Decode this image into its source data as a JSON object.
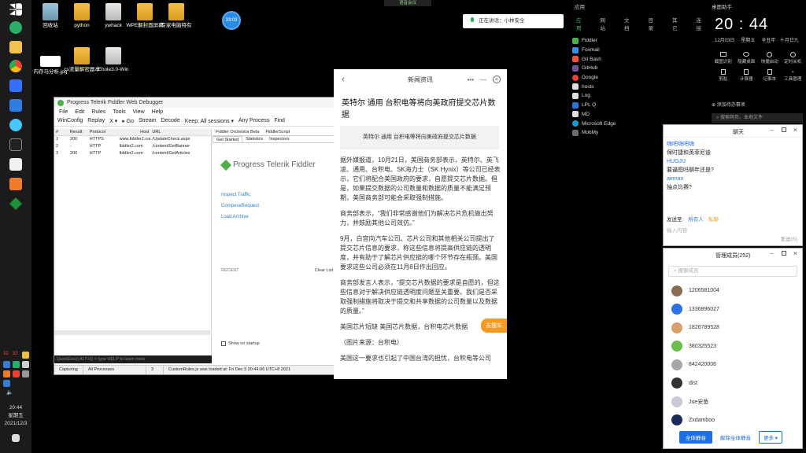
{
  "taskbar": {
    "time": "20:44",
    "weekday": "星期五",
    "date": "2021/12/3",
    "tray_badges": [
      "32",
      "32"
    ]
  },
  "desktop_icons": [
    {
      "label": "回收站"
    },
    {
      "label": "python"
    },
    {
      "label": "ywhack"
    },
    {
      "label": "WPE解封面屏幕"
    },
    {
      "label": "专家电脑特有"
    },
    {
      "label": "内存马分析.jpg"
    },
    {
      "label": "cs流量解密器本"
    },
    {
      "label": "Ehole3.0-Win"
    }
  ],
  "floating_badge": "33:03",
  "top_bar": {
    "text": "语音会议"
  },
  "meeting_pill": {
    "text": "正在讲话：小林安全"
  },
  "fiddler": {
    "title": "Progress Telerik Fiddler Web Debugger",
    "menu": [
      "File",
      "Edit",
      "Rules",
      "Tools",
      "View",
      "Help"
    ],
    "toolbar": [
      "WinConfig",
      "Replay",
      "X ▾",
      "▸ Go",
      "Stream",
      "Decode",
      "Keep: All sessions ▾",
      "Any Process",
      "Find"
    ],
    "columns": [
      "#",
      "Result",
      "Protocol",
      "Host",
      "URL"
    ],
    "sessions": [
      {
        "num": "1",
        "result": "200",
        "protocol": "HTTPS",
        "host": "www.fiddler2.com",
        "url": "/UpdateCheck.aspx"
      },
      {
        "num": "2",
        "result": "-",
        "protocol": "HTTP",
        "host": "fiddler2.com",
        "url": "/content/GetBanner"
      },
      {
        "num": "3",
        "result": "200",
        "protocol": "HTTP",
        "host": "fiddler2.com",
        "url": "/content/GetArticles"
      }
    ],
    "right_tabs_row1": [
      "Fiddler Orchestra Beta",
      "FiddlerScript"
    ],
    "right_tabs_row2": [
      "Get Started",
      "Statistics",
      "Inspectors"
    ],
    "logo_text": "Progress Telerik Fiddler",
    "links": [
      "Inspect Traffic",
      "ComposeRequest",
      "Load Archive"
    ],
    "recent_label": "RECENT",
    "clear_list": "Clear List",
    "show_on_startup": "Show on startup",
    "quickexec": "QuickExec] ALT+Q > type HELP to learn more",
    "status": [
      "Capturing",
      "All Processes",
      "3",
      "CustomRules.js was loaded at: Fri Dec 3 20:44:06 UTC+8 2021"
    ]
  },
  "article": {
    "header": "新闻资讯",
    "title": "英特尔 通用 台积电等将向美政府提交芯片数据",
    "summary": "英特尔 通用 台积电等将向美政府提交芯片数据",
    "paragraphs": [
      "据外媒报道，10月21日，美国商务部表示，英特尔、英飞凌、通用、台积电、SK海力士（SK Hynix）等公司已经表示，它们将配合美国政府的要求，自愿提交芯片数据。但是，如果提交数据的公司数量和数据的质量不能满足预期，美国商务部可能会采取强制措施。",
      "商务部表示，“我们非常感谢他们为解决芯片危机做出努力，并鼓励其他公司效仿。”",
      "9月，白宫向汽车公司、芯片公司和其他相关公司提出了提交芯片信息的要求，称这些信息将提高供应链的透明度，并有助于了解芯片供应链的哪个环节存在瓶颈。美国要求这些公司必须在11月8日作出回应。",
      "商务部发言人表示，“提交芯片数据的要求是自愿的，但这些信息对于解决供应链透明度问题至关重要。我们是否采取强制措施将取决于提交和共享数据的公司数量以及数据的质量。”",
      "美国芯片短缺 美国芯片数据，台积电芯片数据",
      "（图片来源：台积电）",
      "美国这一要求也引起了中国台湾的担忧，台积电等公司"
    ],
    "join_button": "去搜车"
  },
  "apps_panel": {
    "header": "应用",
    "tabs": [
      "应用",
      "网站",
      "文档",
      "目录",
      "其它",
      "连接"
    ],
    "items": [
      "Fiddler",
      "Foxmail",
      "Git Bash",
      "GitHub",
      "Google",
      "hosts",
      "Log",
      "LPL Q",
      "MD",
      "Microsoft Edge",
      "MobMy"
    ]
  },
  "widget": {
    "header": "桌面助手",
    "time": "20 : 44",
    "date": "12月03日",
    "weekday": "星期五",
    "lunar": "辛丑年 · 十月廿九",
    "tools": [
      "截图识别",
      "隐藏桌面",
      "快捷启动",
      "定时关机",
      "剪贴",
      "计算器",
      "记事本",
      "工具管理"
    ],
    "task": "添加待办事项",
    "search_placeholder": "搜索网页、本地文件"
  },
  "chat": {
    "title": "聊天",
    "messages": [
      {
        "name": "嗨吧嗨吧嗨",
        "text": "保时捷和英菲尼迪"
      },
      {
        "name": "HUGJU",
        "text": "要逼图吗聊年还是?"
      },
      {
        "name": "airman",
        "text": "抽点比赛?"
      }
    ],
    "send_to": "发送至:",
    "recipient": "所有人",
    "private_chat": "私聊",
    "input_placeholder": "输入内容",
    "send": "发送(S)"
  },
  "group": {
    "title": "管理成员(252)",
    "search_placeholder": "搜索成员",
    "members": [
      {
        "name": "1206581004",
        "color": "#8a6d4f"
      },
      {
        "name": "1336896027",
        "color": "#2b74e0"
      },
      {
        "name": "1826789528",
        "color": "#d8a06a"
      },
      {
        "name": "380325523",
        "color": "#6abf4b"
      },
      {
        "name": "842420006",
        "color": "#a7a7a7"
      },
      {
        "name": "dist",
        "color": "#333333"
      },
      {
        "name": "Jue安鱼",
        "color": "#c9c9d8"
      },
      {
        "name": "Zxdamboo",
        "color": "#1b2a5a"
      }
    ],
    "mute_all": "全体静音",
    "unmute_all": "解除全体静音",
    "more": "更多 ▾"
  }
}
